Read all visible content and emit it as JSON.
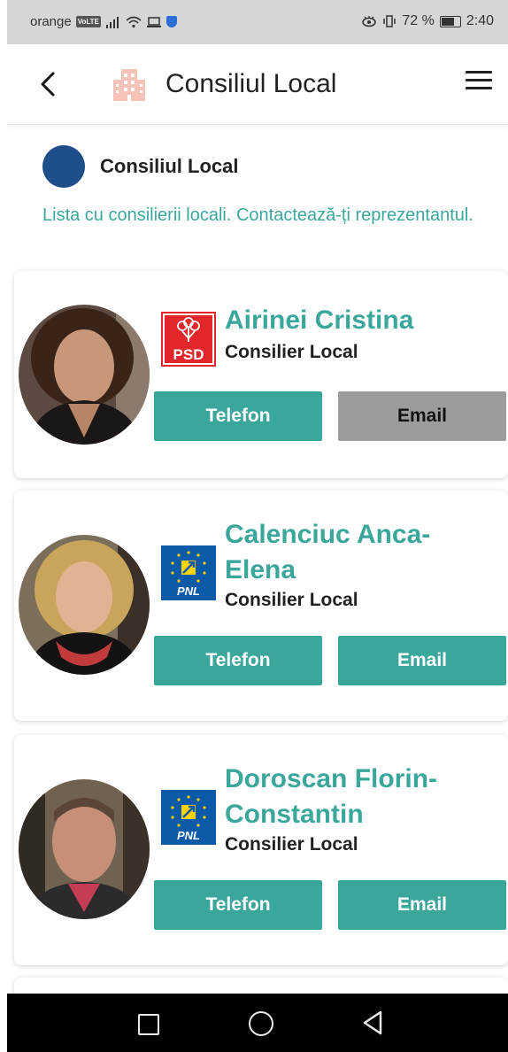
{
  "status_bar": {
    "carrier": "orange",
    "network_badge": "VoLTE",
    "battery_percent": "72 %",
    "time": "2:40"
  },
  "header": {
    "title": "Consiliul Local",
    "icon": "building-icon"
  },
  "section": {
    "title": "Consiliul Local",
    "description": "Lista cu consilierii locali. Contactează-ți reprezentantul."
  },
  "councillors": [
    {
      "name": "Airinei Cristina",
      "role": "Consilier Local",
      "party": "PSD",
      "phone_label": "Telefon",
      "email_label": "Email",
      "email_available": false
    },
    {
      "name": "Calenciuc Anca-Elena",
      "name_lines": [
        "Calenciuc Anca-",
        "Elena"
      ],
      "role": "Consilier Local",
      "party": "PNL",
      "phone_label": "Telefon",
      "email_label": "Email",
      "email_available": true
    },
    {
      "name": "Doroscan Florin-Constantin",
      "name_lines": [
        "Doroscan Florin-",
        "Constantin"
      ],
      "role": "Consilier Local",
      "party": "PNL",
      "phone_label": "Telefon",
      "email_label": "Email",
      "email_available": true
    }
  ],
  "colors": {
    "accent": "#3aa79a",
    "disabled": "#9c9c9c",
    "section_dot": "#1f4f8b",
    "psd_red": "#e2262a",
    "pnl_blue": "#0b5aa8",
    "pnl_yellow": "#ffd200"
  }
}
